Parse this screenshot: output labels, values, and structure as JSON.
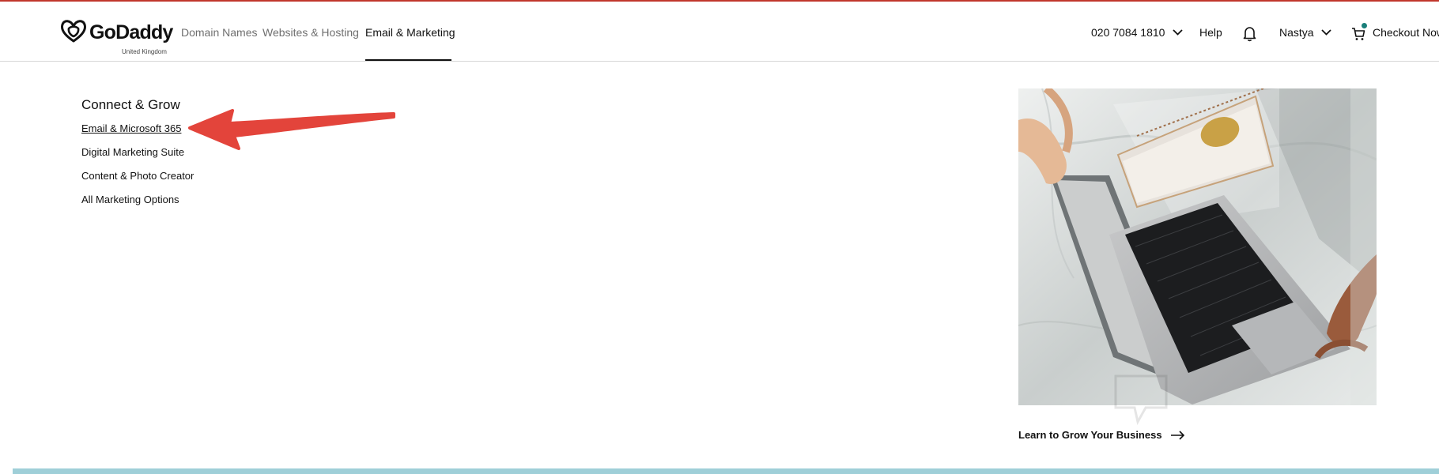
{
  "brand": {
    "name": "GoDaddy",
    "region": "United Kingdom"
  },
  "nav": {
    "items": [
      {
        "label": "Domain Names"
      },
      {
        "label": "Websites & Hosting"
      },
      {
        "label": "Email & Marketing",
        "active": true
      }
    ]
  },
  "header_right": {
    "phone": "020 7084 1810",
    "help": "Help",
    "user": "Nastya",
    "checkout": "Checkout Now"
  },
  "menu": {
    "title": "Connect & Grow",
    "links": [
      {
        "label": "Email & Microsoft 365"
      },
      {
        "label": "Digital Marketing Suite"
      },
      {
        "label": "Content & Photo Creator"
      },
      {
        "label": "All Marketing Options"
      }
    ]
  },
  "promo": {
    "link": "Learn to Grow Your Business"
  },
  "colors": {
    "annotation_arrow": "#e3443b",
    "cart_badge": "#1a7f7a",
    "top_accent": "#c0362c"
  }
}
